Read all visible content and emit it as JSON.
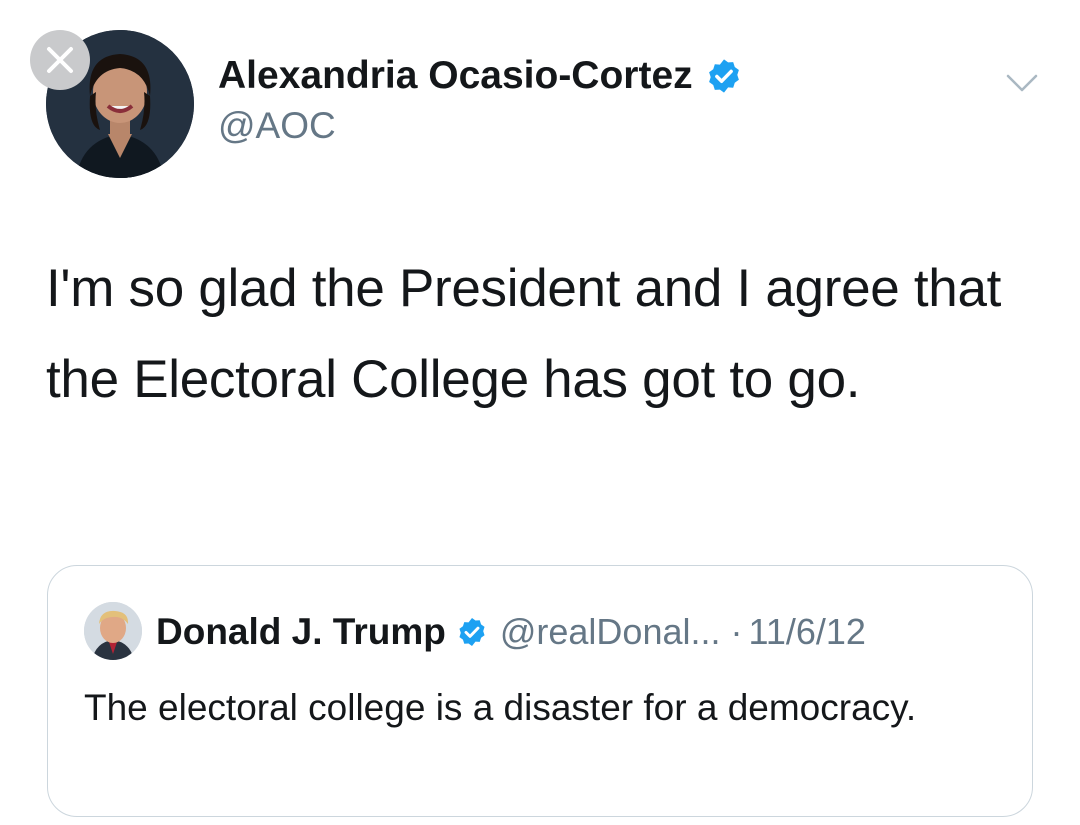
{
  "tweet": {
    "author": {
      "display_name": "Alexandria Ocasio-Cortez",
      "handle": "@AOC",
      "verified": true
    },
    "text": "I'm so glad the President and I agree that the Electoral College has got to go."
  },
  "quoted_tweet": {
    "author": {
      "display_name": "Donald J. Trump",
      "handle": "@realDonal...",
      "verified": true
    },
    "separator": "·",
    "date": "11/6/12",
    "text": "The electoral college is a disaster for a democracy."
  },
  "icons": {
    "close": "close-icon",
    "verified": "verified-badge-icon",
    "menu": "chevron-down-icon"
  },
  "colors": {
    "verified_blue": "#1da1f2",
    "secondary_text": "#657786",
    "card_border": "#ccd6dd",
    "close_button": "#c9cacc"
  }
}
